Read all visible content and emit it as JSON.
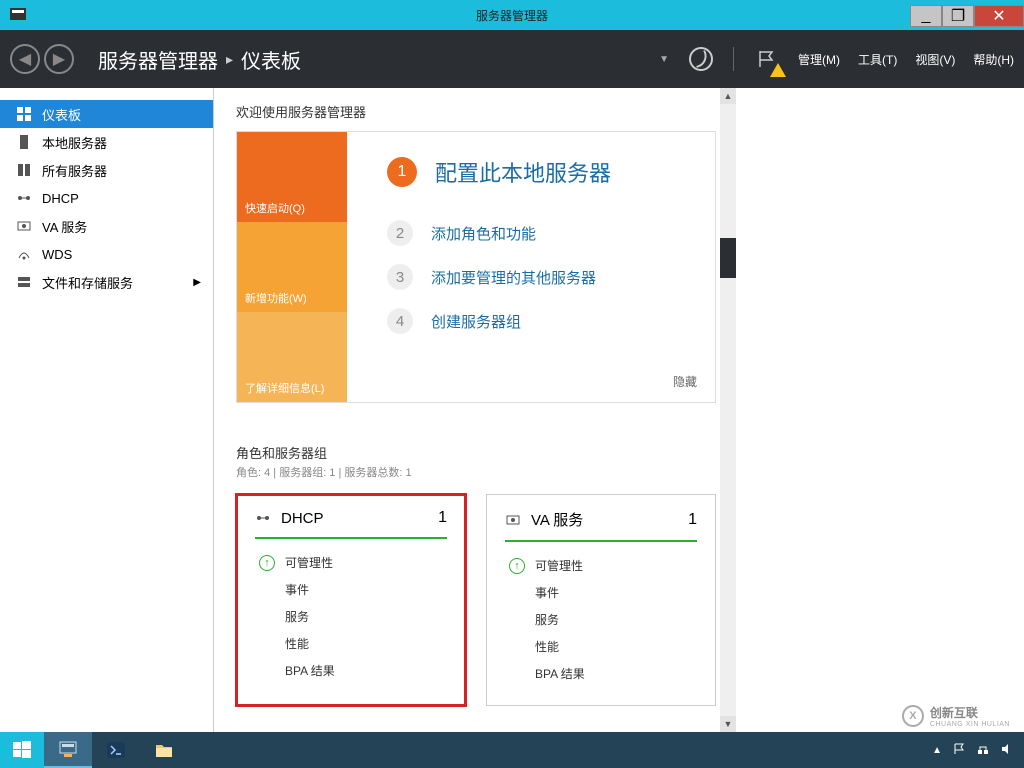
{
  "window": {
    "title": "服务器管理器",
    "minimize": "_",
    "maximize": "❐",
    "close": "✕"
  },
  "header": {
    "breadcrumb_root": "服务器管理器",
    "breadcrumb_current": "仪表板",
    "menu": {
      "manage": "管理(M)",
      "tools": "工具(T)",
      "view": "视图(V)",
      "help": "帮助(H)"
    }
  },
  "sidebar": {
    "items": [
      {
        "label": "仪表板"
      },
      {
        "label": "本地服务器"
      },
      {
        "label": "所有服务器"
      },
      {
        "label": "DHCP"
      },
      {
        "label": "VA 服务"
      },
      {
        "label": "WDS"
      },
      {
        "label": "文件和存储服务"
      }
    ]
  },
  "welcome": {
    "heading": "欢迎使用服务器管理器",
    "tabs": {
      "quickstart": "快速启动(Q)",
      "whatsnew": "新增功能(W)",
      "learnmore": "了解详细信息(L)"
    },
    "steps": {
      "s1": "配置此本地服务器",
      "s2": "添加角色和功能",
      "s3": "添加要管理的其他服务器",
      "s4": "创建服务器组"
    },
    "nums": {
      "n1": "1",
      "n2": "2",
      "n3": "3",
      "n4": "4"
    },
    "hide": "隐藏"
  },
  "roles": {
    "heading": "角色和服务器组",
    "subheading": "角色: 4 | 服务器组: 1 | 服务器总数: 1",
    "cards": [
      {
        "title": "DHCP",
        "count": "1"
      },
      {
        "title": "VA 服务",
        "count": "1"
      }
    ],
    "rows": {
      "manageability": "可管理性",
      "events": "事件",
      "services": "服务",
      "performance": "性能",
      "bpa": "BPA 结果"
    }
  },
  "watermark": {
    "brand_cn": "创新互联",
    "brand_en": "CHUANG XIN HULIAN"
  },
  "tray": {
    "up": "▲"
  }
}
